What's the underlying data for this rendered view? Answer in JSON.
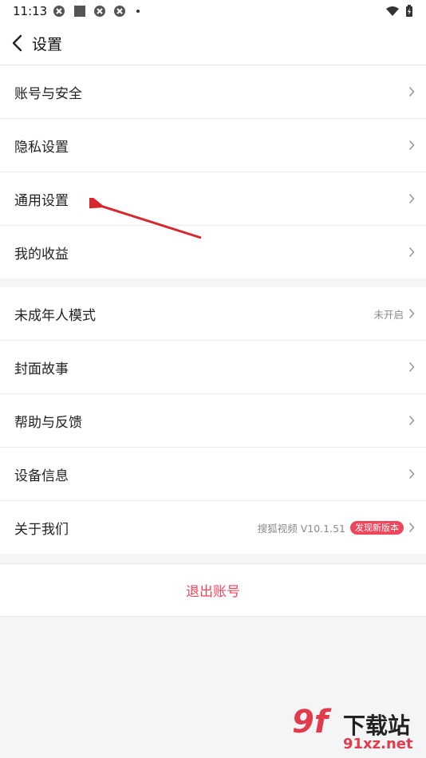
{
  "status_bar": {
    "time": "11:13"
  },
  "header": {
    "title": "设置"
  },
  "groups": [
    {
      "items": [
        {
          "label": "账号与安全"
        },
        {
          "label": "隐私设置"
        },
        {
          "label": "通用设置"
        },
        {
          "label": "我的收益"
        }
      ]
    },
    {
      "items": [
        {
          "label": "未成年人模式",
          "value": "未开启"
        },
        {
          "label": "封面故事"
        },
        {
          "label": "帮助与反馈"
        },
        {
          "label": "设备信息"
        },
        {
          "label": "关于我们",
          "value": "搜狐视频 V10.1.51",
          "badge": "发现新版本"
        }
      ]
    }
  ],
  "logout": {
    "label": "退出账号"
  },
  "annotation": {
    "arrow_color": "#d9262c"
  },
  "watermark": {
    "logo": "9f",
    "title": "下载站",
    "url": "91xz.net"
  },
  "colors": {
    "accent": "#f0455b",
    "background": "#f4f5f7"
  }
}
